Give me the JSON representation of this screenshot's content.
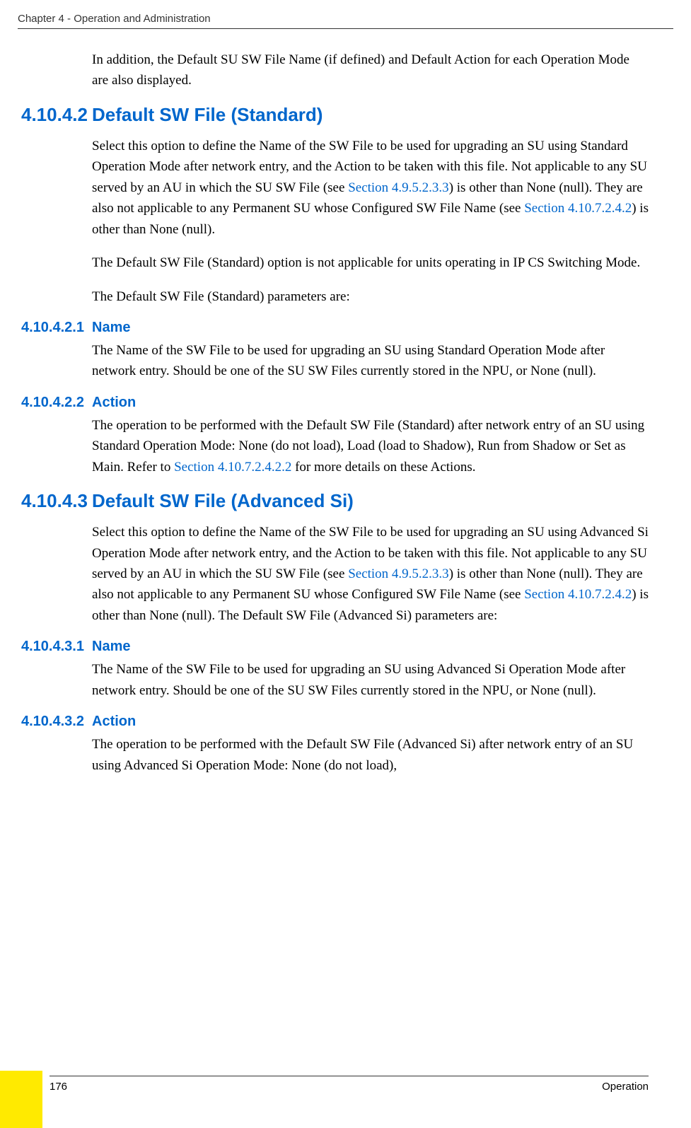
{
  "header": {
    "text": "Chapter 4 - Operation and Administration"
  },
  "intro": {
    "text": "In addition, the Default SU SW File Name (if defined) and Default Action for each Operation Mode are also displayed."
  },
  "sec_4_10_4_2": {
    "num": "4.10.4.2",
    "title": "Default SW File (Standard)",
    "p1_a": "Select this option to define the Name of the SW File to be used for upgrading an SU using Standard Operation Mode after network entry, and the Action to be taken with this file. Not applicable to any SU served by an AU in which the SU SW File (see ",
    "p1_link1": "Section 4.9.5.2.3.3",
    "p1_b": ") is other than None (null). They are also not applicable to any Permanent SU whose Configured SW File Name (see ",
    "p1_link2": "Section 4.10.7.2.4.2",
    "p1_c": ") is other than None (null).",
    "p2": "The Default SW File (Standard) option is not applicable for units operating in IP CS Switching Mode.",
    "p3": "The Default SW File (Standard) parameters are:"
  },
  "sec_4_10_4_2_1": {
    "num": "4.10.4.2.1",
    "title": "Name",
    "p1": "The Name of the SW File to be used for upgrading an SU using Standard Operation Mode after network entry. Should be one of the SU SW Files currently stored in the NPU, or None (null)."
  },
  "sec_4_10_4_2_2": {
    "num": "4.10.4.2.2",
    "title": "Action",
    "p1_a": "The operation to be performed with the Default SW File (Standard) after network entry of an SU using Standard Operation Mode: None (do not load), Load (load to Shadow), Run from Shadow or Set as Main. Refer to ",
    "p1_link1": "Section 4.10.7.2.4.2.2",
    "p1_b": " for more details on these Actions."
  },
  "sec_4_10_4_3": {
    "num": "4.10.4.3",
    "title": "Default SW File (Advanced Si)",
    "p1_a": "Select this option to define the Name of the SW File to be used for upgrading an SU using Advanced Si Operation Mode after network entry, and the Action to be taken with this file. Not applicable to any SU served by an AU in which the SU SW File (see ",
    "p1_link1": "Section 4.9.5.2.3.3",
    "p1_b": ") is other than None (null). They are also not applicable to any Permanent SU whose Configured SW File Name (see ",
    "p1_link2": "Section 4.10.7.2.4.2",
    "p1_c": ") is other than None (null). The Default SW File (Advanced Si) parameters are:"
  },
  "sec_4_10_4_3_1": {
    "num": "4.10.4.3.1",
    "title": "Name",
    "p1": "The Name of the SW File to be used for upgrading an SU using Advanced Si Operation Mode after network entry. Should be one of the SU SW Files currently stored in the NPU, or None (null)."
  },
  "sec_4_10_4_3_2": {
    "num": "4.10.4.3.2",
    "title": "Action",
    "p1": "The operation to be performed with the Default SW File (Advanced Si) after network entry of an SU using Advanced Si Operation Mode: None (do not load),"
  },
  "footer": {
    "page": "176",
    "label": "Operation"
  }
}
